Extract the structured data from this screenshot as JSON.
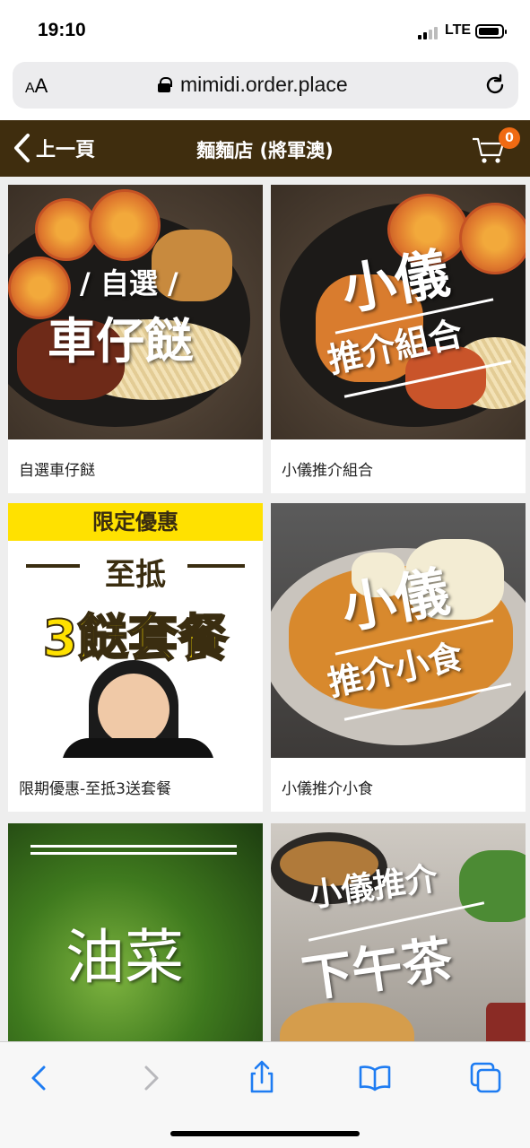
{
  "status": {
    "time": "19:10",
    "network": "LTE"
  },
  "browser": {
    "text_size": "AA",
    "url": "mimidi.order.place"
  },
  "header": {
    "back_label": "上一頁",
    "title": "麵麵店 (將軍澳)",
    "cart_count": "0"
  },
  "menu_items": [
    {
      "label": "自選車仔餸",
      "image_text": [
        "/ 自選 /",
        "車仔餸"
      ]
    },
    {
      "label": "小儀推介組合",
      "image_text": [
        "小儀",
        "推介組合"
      ]
    },
    {
      "label": "限期優惠-至抵3送套餐",
      "image_text": [
        "限定優惠",
        "至抵",
        "3餸套餐"
      ]
    },
    {
      "label": "小儀推介小食",
      "image_text": [
        "小儀",
        "推介小食"
      ]
    },
    {
      "label": "",
      "image_text": [
        "油菜"
      ]
    },
    {
      "label": "",
      "image_text": [
        "小儀推介",
        "下午茶"
      ]
    }
  ],
  "toolbar": {
    "icons": [
      "back-icon",
      "forward-icon",
      "share-icon",
      "bookmarks-icon",
      "tabs-icon"
    ]
  },
  "colors": {
    "header_bg": "#3f2d0e",
    "badge": "#f06a12",
    "promo_yellow": "#ffe100",
    "ios_blue": "#1e7cf2"
  }
}
